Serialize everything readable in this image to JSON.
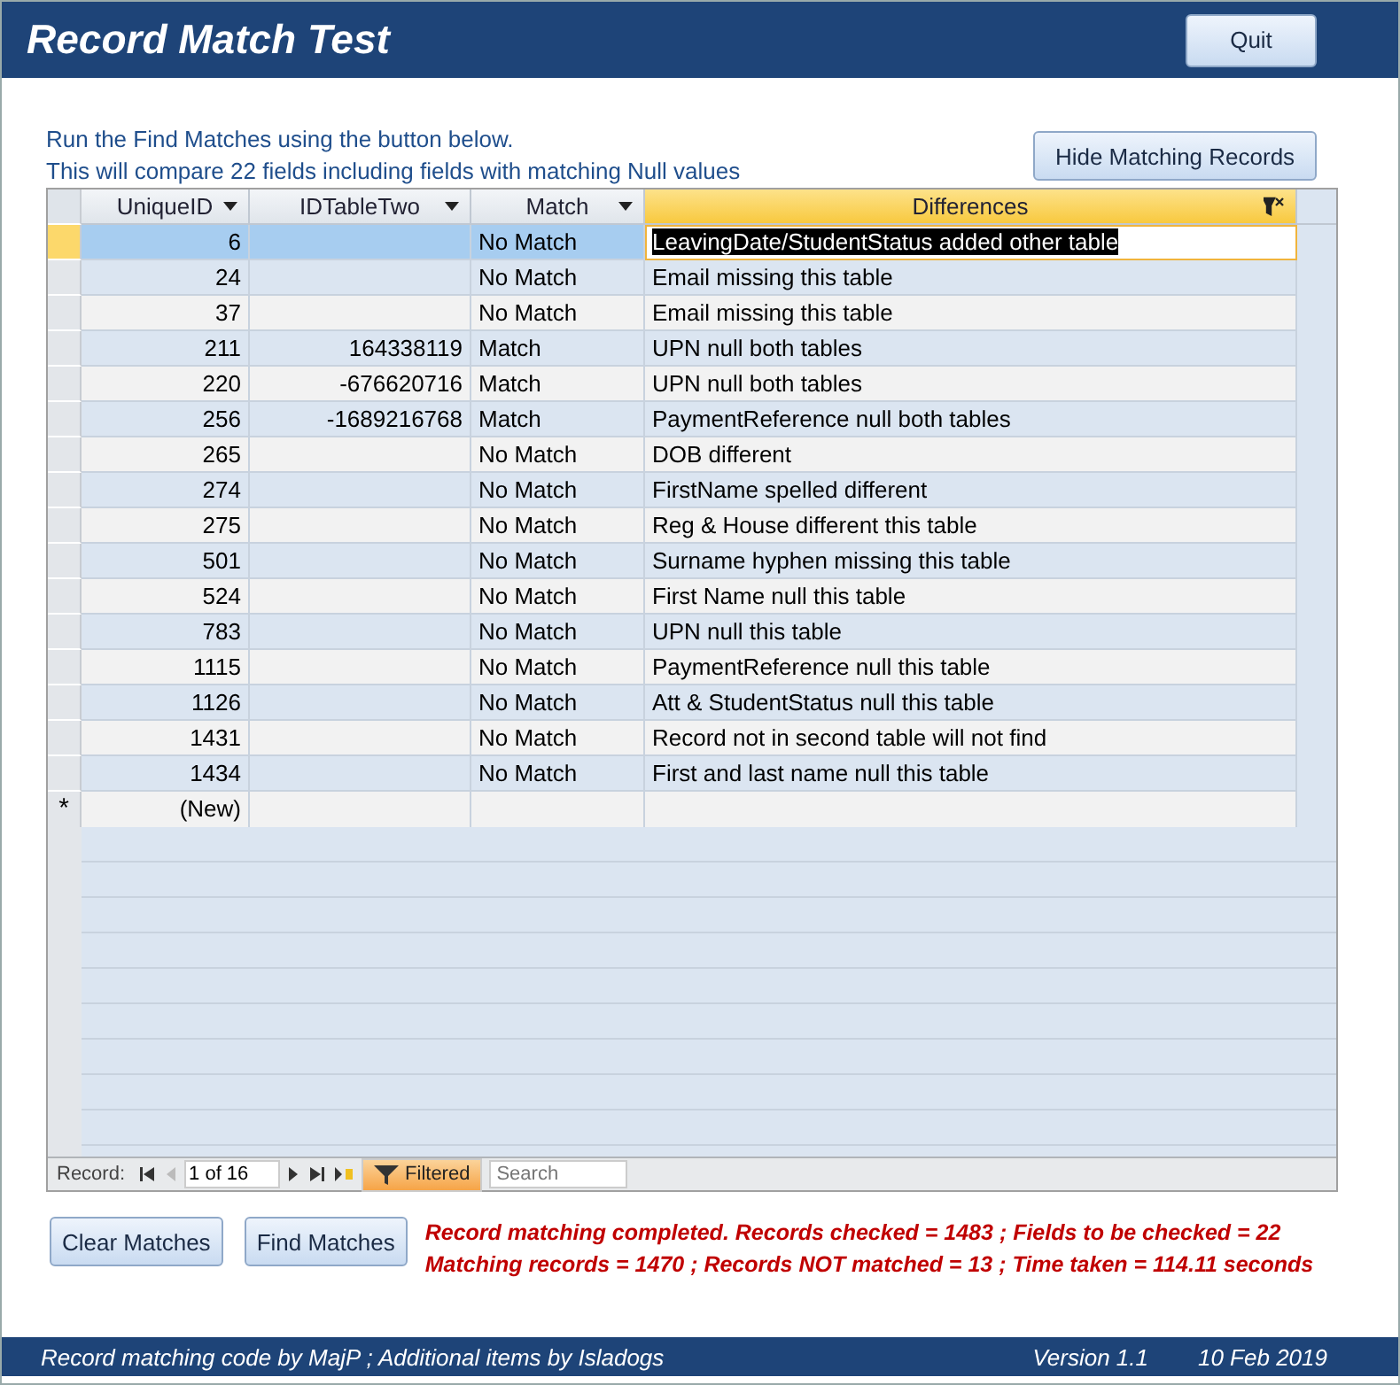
{
  "window": {
    "title": "Record Match Test"
  },
  "quit_button": "Quit",
  "instructions": [
    "Run the Find Matches using the button below.",
    "This will compare 22 fields including fields with matching Null values"
  ],
  "hide_button": "Hide Matching Records",
  "table": {
    "columns": [
      {
        "label": "UniqueID",
        "filtered": false
      },
      {
        "label": "IDTableTwo",
        "filtered": false
      },
      {
        "label": "Match",
        "filtered": false
      },
      {
        "label": "Differences",
        "filtered": true
      }
    ],
    "rows": [
      {
        "cells": [
          "6",
          "",
          "No Match",
          "LeavingDate/StudentStatus added other table"
        ],
        "selected": true
      },
      {
        "cells": [
          "24",
          "",
          "No Match",
          "Email missing this table"
        ],
        "selected": false
      },
      {
        "cells": [
          "37",
          "",
          "No Match",
          "Email missing this table"
        ],
        "selected": false
      },
      {
        "cells": [
          "211",
          "164338119",
          "Match",
          "UPN null both tables"
        ],
        "selected": false
      },
      {
        "cells": [
          "220",
          "-676620716",
          "Match",
          "UPN null both tables"
        ],
        "selected": false
      },
      {
        "cells": [
          "256",
          "-1689216768",
          "Match",
          "PaymentReference null both tables"
        ],
        "selected": false
      },
      {
        "cells": [
          "265",
          "",
          "No Match",
          "DOB different"
        ],
        "selected": false
      },
      {
        "cells": [
          "274",
          "",
          "No Match",
          "FirstName spelled different"
        ],
        "selected": false
      },
      {
        "cells": [
          "275",
          "",
          "No Match",
          "Reg & House different this table"
        ],
        "selected": false
      },
      {
        "cells": [
          "501",
          "",
          "No Match",
          "Surname hyphen missing this table"
        ],
        "selected": false
      },
      {
        "cells": [
          "524",
          "",
          "No Match",
          "First Name null this table"
        ],
        "selected": false
      },
      {
        "cells": [
          "783",
          "",
          "No Match",
          "UPN null this table"
        ],
        "selected": false
      },
      {
        "cells": [
          "1115",
          "",
          "No Match",
          "PaymentReference null this table"
        ],
        "selected": false
      },
      {
        "cells": [
          "1126",
          "",
          "No Match",
          "Att & StudentStatus null this table"
        ],
        "selected": false
      },
      {
        "cells": [
          "1431",
          "",
          "No Match",
          "Record not in second table will not find"
        ],
        "selected": false
      },
      {
        "cells": [
          "1434",
          "",
          "No Match",
          "First and last name null this table"
        ],
        "selected": false
      }
    ],
    "new_row": {
      "marker": "*",
      "label": "(New)"
    }
  },
  "navigation": {
    "label": "Record:",
    "position": "1 of 16",
    "filter": "Filtered",
    "filter_on": true,
    "search_placeholder": "Search"
  },
  "buttons": [
    "Clear Matches",
    "Find Matches"
  ],
  "status": [
    "Record matching completed. Records checked = 1483 ; Fields to be checked = 22",
    "Matching records = 1470 ; Records NOT matched = 13 ; Time taken = 114.11 seconds"
  ],
  "footer": {
    "credits": "Record matching code by MajP  ;  Additional items by Isladogs",
    "version": "Version 1.1",
    "date": "10 Feb 2019"
  }
}
